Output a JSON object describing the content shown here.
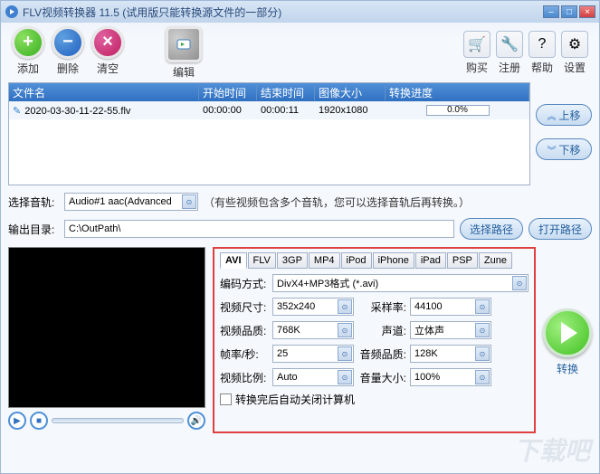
{
  "title": "FLV视频转换器 11.5 (试用版只能转换源文件的一部分)",
  "toolbar": {
    "add": "添加",
    "del": "删除",
    "clear": "清空",
    "edit": "编辑",
    "buy": "购买",
    "register": "注册",
    "help": "帮助",
    "settings": "设置"
  },
  "table": {
    "headers": {
      "name": "文件名",
      "start": "开始时间",
      "end": "结束时间",
      "size": "图像大小",
      "progress": "转换进度"
    },
    "rows": [
      {
        "name": "2020-03-30-11-22-55.flv",
        "start": "00:00:00",
        "end": "00:00:11",
        "size": "1920x1080",
        "progress": "0.0%"
      }
    ]
  },
  "sidebtns": {
    "up": "上移",
    "down": "下移"
  },
  "audio": {
    "label": "选择音轨:",
    "value": "Audio#1 aac(Advanced",
    "hint": "（有些视频包含多个音轨，您可以选择音轨后再转换。）"
  },
  "output": {
    "label": "输出目录:",
    "value": "C:\\OutPath\\",
    "choose": "选择路径",
    "open": "打开路径"
  },
  "tabs": [
    "AVI",
    "FLV",
    "3GP",
    "MP4",
    "iPod",
    "iPhone",
    "iPad",
    "PSP",
    "Zune"
  ],
  "settings": {
    "codec_label": "编码方式:",
    "codec": "DivX4+MP3格式 (*.avi)",
    "vsize_label": "视频尺寸:",
    "vsize": "352x240",
    "sample_label": "采样率:",
    "sample": "44100",
    "vqual_label": "视频品质:",
    "vqual": "768K",
    "channel_label": "声道:",
    "channel": "立体声",
    "fps_label": "帧率/秒:",
    "fps": "25",
    "aqual_label": "音频品质:",
    "aqual": "128K",
    "ratio_label": "视频比例:",
    "ratio": "Auto",
    "vol_label": "音量大小:",
    "vol": "100%",
    "shutdown": "转换完后自动关闭计算机"
  },
  "convert": "转换",
  "watermark": "下载吧"
}
